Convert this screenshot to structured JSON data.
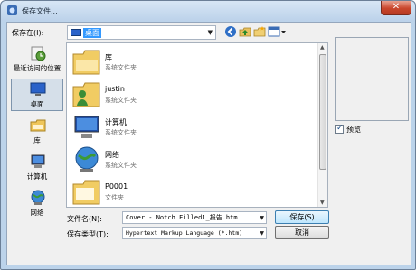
{
  "window": {
    "title": "保存文件..."
  },
  "toolbar": {
    "save_in_label": "保存在(I):",
    "current_location": "桌面",
    "icons": [
      "back-icon",
      "up-folder-icon",
      "new-folder-icon",
      "view-menu-icon"
    ]
  },
  "places": [
    {
      "label": "最近访问的位置",
      "icon": "recent-places-icon"
    },
    {
      "label": "桌面",
      "icon": "desktop-icon",
      "selected": true
    },
    {
      "label": "库",
      "icon": "libraries-icon"
    },
    {
      "label": "计算机",
      "icon": "computer-icon"
    },
    {
      "label": "网络",
      "icon": "network-icon"
    }
  ],
  "files": [
    {
      "name": "库",
      "type": "系统文件夹",
      "icon": "libraries-folder-icon"
    },
    {
      "name": "justin",
      "type": "系统文件夹",
      "icon": "user-folder-icon"
    },
    {
      "name": "计算机",
      "type": "系统文件夹",
      "icon": "computer-icon"
    },
    {
      "name": "网络",
      "type": "系统文件夹",
      "icon": "network-icon"
    },
    {
      "name": "P0001",
      "type": "文件夹",
      "icon": "folder-icon"
    }
  ],
  "preview": {
    "label": "预览",
    "checked": true
  },
  "form": {
    "filename_label": "文件名(N):",
    "filename_value": "Cover - Notch Filled1_报告.htm",
    "filetype_label": "保存类型(T):",
    "filetype_value": "Hypertext Markup Language (*.htm)"
  },
  "buttons": {
    "save": "保存(S)",
    "cancel": "取消"
  },
  "colors": {
    "selection": "#3399ff",
    "titlebar": "#bcd2ea",
    "close": "#c9462c"
  }
}
